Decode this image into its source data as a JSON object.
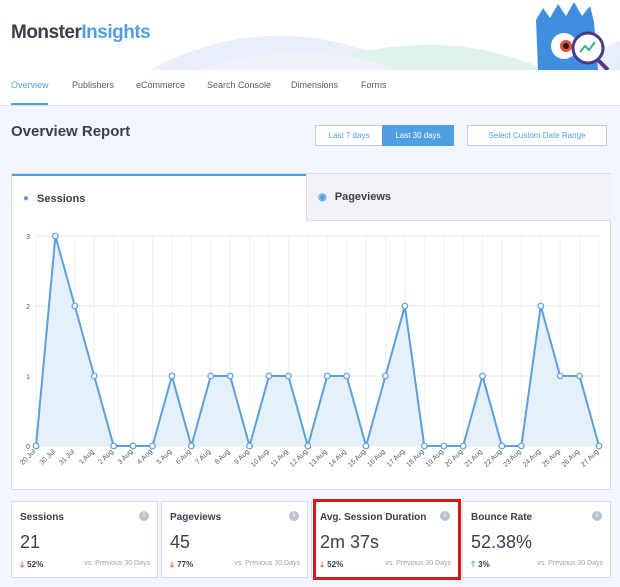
{
  "brand": {
    "part1": "Monster",
    "part2": "Insights"
  },
  "colors": {
    "accent": "#509fe2",
    "down": "#e94e3d",
    "up": "#31b78b",
    "highlight": "#d11a1a"
  },
  "nav_tabs": [
    {
      "label": "Overview",
      "active": true
    },
    {
      "label": "Publishers",
      "active": false
    },
    {
      "label": "eCommerce",
      "active": false
    },
    {
      "label": "Search Console",
      "active": false
    },
    {
      "label": "Dimensions",
      "active": false
    },
    {
      "label": "Forms",
      "active": false
    }
  ],
  "report": {
    "title": "Overview Report",
    "btn_7": "Last 7 days",
    "btn_30": "Last 30 days",
    "btn_custom": "Select Custom Date Range",
    "selected_range": "Last 30 days"
  },
  "panel_tabs": {
    "sessions": {
      "label": "Sessions",
      "icon": "user-icon",
      "active": true
    },
    "pageviews": {
      "label": "Pageviews",
      "icon": "eye-icon",
      "active": false
    }
  },
  "chart_data": {
    "type": "area",
    "x": [
      "20 Jul",
      "30 Jul",
      "31 Jul",
      "1 Aug",
      "2 Aug",
      "3 Aug",
      "4 Aug",
      "5 Aug",
      "6 Aug",
      "7 Aug",
      "8 Aug",
      "9 Aug",
      "10 Aug",
      "11 Aug",
      "12 Aug",
      "13 Aug",
      "14 Aug",
      "15 Aug",
      "16 Aug",
      "17 Aug",
      "18 Aug",
      "19 Aug",
      "20 Aug",
      "21 Aug",
      "22 Aug",
      "23 Aug",
      "24 Aug",
      "25 Aug",
      "26 Aug",
      "27 Aug"
    ],
    "series": [
      {
        "values": [
          0,
          3,
          2,
          1,
          0,
          0,
          0,
          1,
          0,
          1,
          1,
          0,
          1,
          1,
          0,
          1,
          1,
          0,
          1,
          2,
          0,
          0,
          0,
          1,
          0,
          0,
          2,
          1,
          1,
          0
        ]
      }
    ],
    "ylim": [
      0,
      3
    ],
    "yticks": [
      0,
      1,
      2,
      3
    ],
    "grid": true
  },
  "stats": [
    {
      "label": "Sessions",
      "value": "21",
      "change": "52%",
      "direction": "down",
      "compare": "vs. Previous 30 Days"
    },
    {
      "label": "Pageviews",
      "value": "45",
      "change": "77%",
      "direction": "down",
      "compare": "vs. Previous 30 Days"
    },
    {
      "label": "Avg. Session Duration",
      "value": "2m 37s",
      "change": "52%",
      "direction": "down",
      "compare": "vs. Previous 30 Days"
    },
    {
      "label": "Bounce Rate",
      "value": "52.38%",
      "change": "3%",
      "direction": "up",
      "compare": "vs. Previous 30 Days"
    }
  ]
}
